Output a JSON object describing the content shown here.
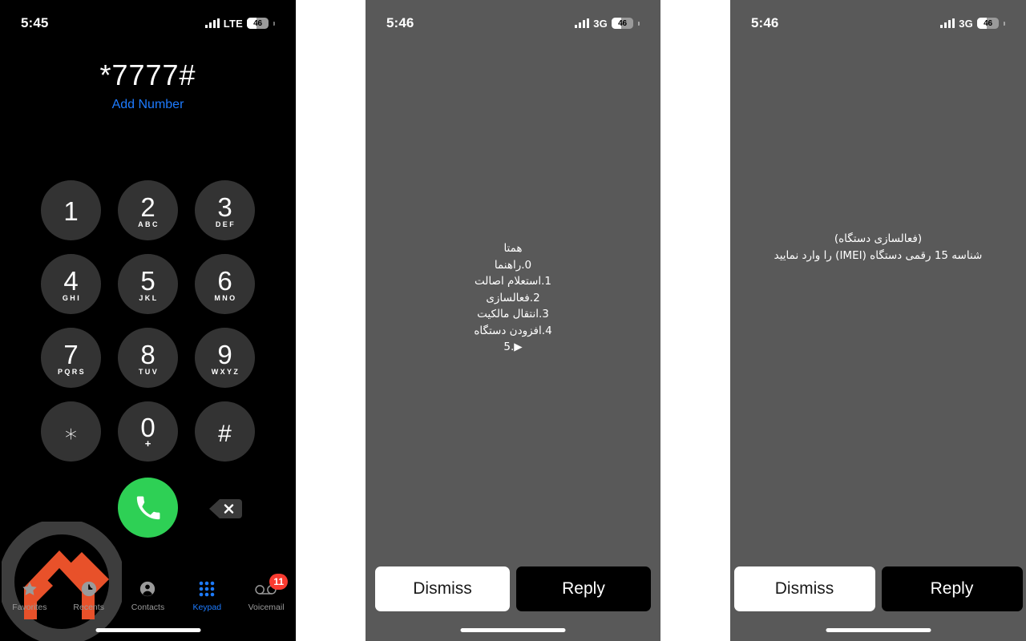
{
  "screens": [
    {
      "id": "dialer",
      "status": {
        "time": "5:45",
        "network": "LTE",
        "battery": "46",
        "signal_bars": 4
      },
      "display": {
        "number": "*7777#",
        "add_number_label": "Add Number"
      },
      "keypad": [
        {
          "digit": "1",
          "letters": ""
        },
        {
          "digit": "2",
          "letters": "ABC"
        },
        {
          "digit": "3",
          "letters": "DEF"
        },
        {
          "digit": "4",
          "letters": "GHI"
        },
        {
          "digit": "5",
          "letters": "JKL"
        },
        {
          "digit": "6",
          "letters": "MNO"
        },
        {
          "digit": "7",
          "letters": "PQRS"
        },
        {
          "digit": "8",
          "letters": "TUV"
        },
        {
          "digit": "9",
          "letters": "WXYZ"
        },
        {
          "digit": "∗",
          "letters": ""
        },
        {
          "digit": "0",
          "letters": "+"
        },
        {
          "digit": "#",
          "letters": ""
        }
      ],
      "call_button_icon": "phone-icon",
      "backspace_icon": "backspace-icon",
      "tabs": [
        {
          "label": "Favorites",
          "icon": "star-icon",
          "active": false,
          "badge": ""
        },
        {
          "label": "Recents",
          "icon": "clock-icon",
          "active": false,
          "badge": ""
        },
        {
          "label": "Contacts",
          "icon": "person-icon",
          "active": false,
          "badge": ""
        },
        {
          "label": "Keypad",
          "icon": "keypad-icon",
          "active": true,
          "badge": ""
        },
        {
          "label": "Voicemail",
          "icon": "voicemail-icon",
          "active": false,
          "badge": "11"
        }
      ],
      "watermark": {
        "icon": "mountain-chevron-logo",
        "ring_color": "#3d3d3d",
        "mark_color": "#e8512a"
      }
    },
    {
      "id": "ussd-menu",
      "status": {
        "time": "5:46",
        "network": "3G",
        "battery": "46",
        "signal_bars": 4
      },
      "message_lines": [
        "همتا",
        "0.راهنما",
        "1.استعلام اصالت",
        "2.فعالسازی",
        "3.انتقال مالکیت",
        "4.افزودن دستگاه",
        "5.▶"
      ],
      "actions": {
        "dismiss_label": "Dismiss",
        "reply_label": "Reply"
      }
    },
    {
      "id": "ussd-imei",
      "status": {
        "time": "5:46",
        "network": "3G",
        "battery": "46",
        "signal_bars": 4
      },
      "message_lines": [
        "(فعالسازی دستگاه)",
        "شناسه 15 رقمی دستگاه (IMEI) را وارد نمایید"
      ],
      "actions": {
        "dismiss_label": "Dismiss",
        "reply_label": "Reply"
      }
    }
  ],
  "colors": {
    "dialer_background": "#000000",
    "ussd_background": "#595959",
    "key_background": "#333333",
    "accent_blue": "#1d7bff",
    "call_green": "#2ed055",
    "badge_red": "#fa3b30",
    "logo_orange": "#e8512a"
  }
}
